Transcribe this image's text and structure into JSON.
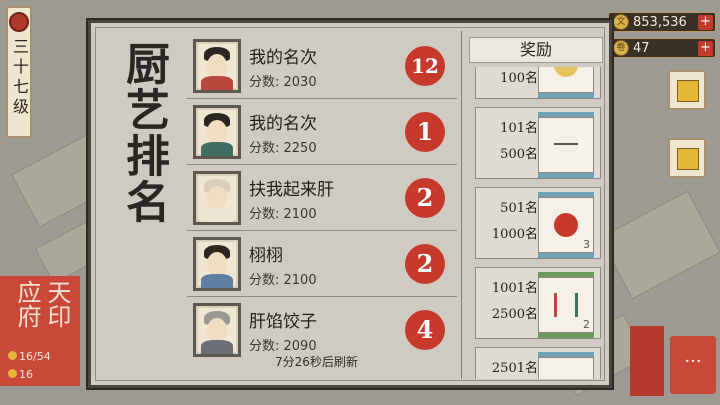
{
  "hud": {
    "level_label": "三十七级",
    "coins": "853,536",
    "tokens": "47",
    "coin_icon": "coin-icon",
    "token_icon": "scroll-token-icon",
    "add_symbol": "+",
    "more_symbol": "···"
  },
  "district": {
    "name": "天印应府",
    "stat_a": "16/54",
    "stat_b": "16"
  },
  "panel": {
    "title": "厨艺排名",
    "refresh_text": "7分26秒后刷新",
    "rankings": [
      {
        "name": "我的名次",
        "score": "分数: 2030",
        "rank": "12"
      },
      {
        "name": "我的名次",
        "score": "分数: 2250",
        "rank": "1"
      },
      {
        "name": "扶我起来肝",
        "score": "分数: 2100",
        "rank": "2"
      },
      {
        "name": "栩栩",
        "score": "分数: 2100",
        "rank": "2"
      },
      {
        "name": "肝馅饺子",
        "score": "分数: 2090",
        "rank": "4"
      }
    ],
    "rewards_header": "奖励",
    "rewards": [
      {
        "range_top": "100名",
        "range_bottom": "",
        "qty": ""
      },
      {
        "range_top": "101名",
        "range_bottom": "500名",
        "qty": ""
      },
      {
        "range_top": "501名",
        "range_bottom": "1000名",
        "qty": "3"
      },
      {
        "range_top": "1001名",
        "range_bottom": "2500名",
        "qty": "2"
      },
      {
        "range_top": "2501名",
        "range_bottom": "",
        "qty": ""
      }
    ]
  },
  "colors": {
    "rank_red": "#c6392b",
    "scroll_blue": "#6fa2b5",
    "scroll_green": "#6a9a5a"
  }
}
